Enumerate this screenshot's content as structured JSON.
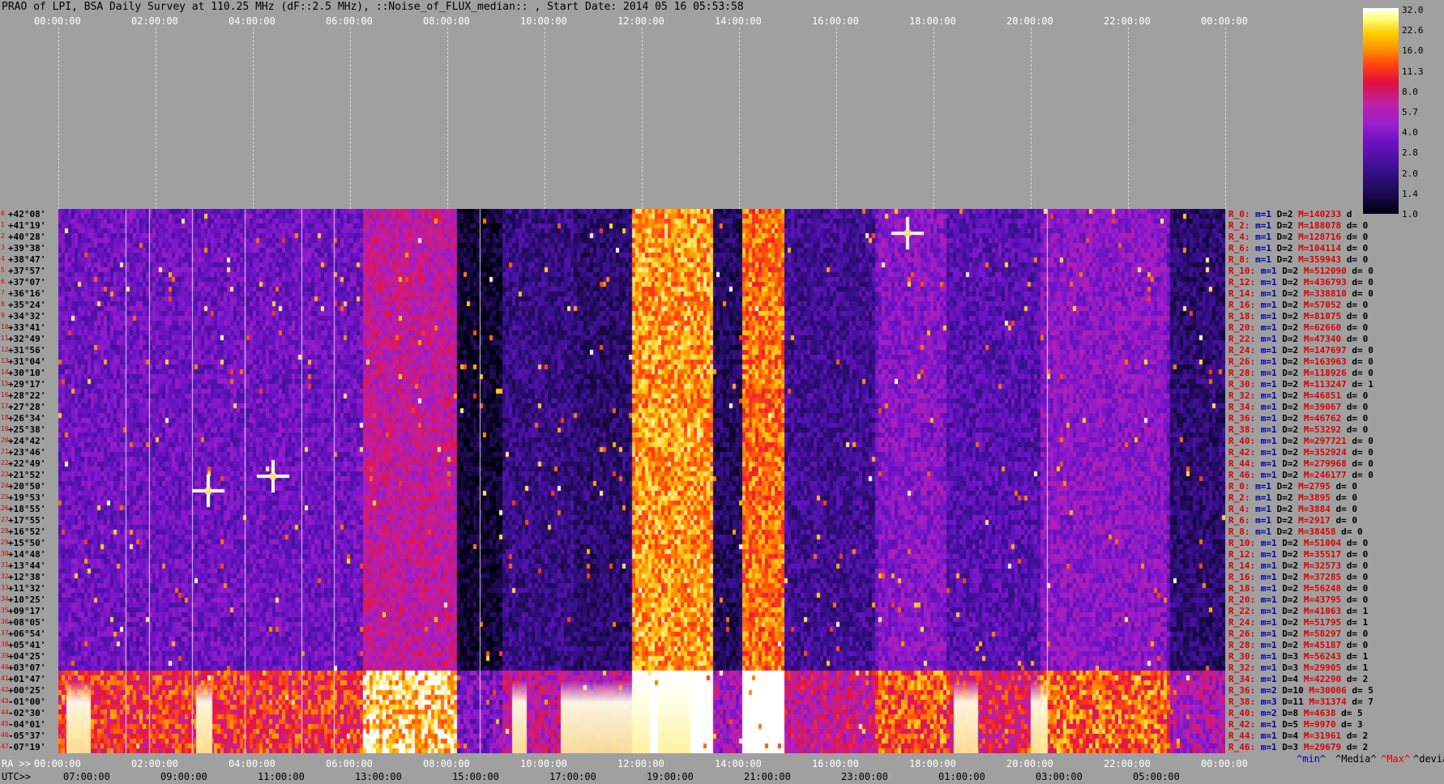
{
  "header": {
    "title": "PRAO of LPI, BSA Daily Survey at 110.25 MHz (dF::2.5 MHz), ::Noise_of_FLUX_median:: , Start Date: 2014 05 16 05:53:58"
  },
  "top_axis": {
    "ticks": [
      "00:00:00",
      "02:00:00",
      "04:00:00",
      "06:00:00",
      "08:00:00",
      "10:00:00",
      "12:00:00",
      "14:00:00",
      "16:00:00",
      "18:00:00",
      "20:00:00",
      "22:00:00",
      "00:00:00"
    ]
  },
  "colorbar": {
    "ticks": [
      "32.0",
      "22.6",
      "16.0",
      "11.3",
      "8.0",
      "5.7",
      "4.0",
      "2.8",
      "2.0",
      "1.4",
      "1.0"
    ]
  },
  "declinations": [
    "+42°08'",
    "+41°19'",
    "+40°28'",
    "+39°38'",
    "+38°47'",
    "+37°57'",
    "+37°07'",
    "+36°16'",
    "+35°24'",
    "+34°32'",
    "+33°41'",
    "+32°49'",
    "+31°56'",
    "+31°04'",
    "+30°10'",
    "+29°17'",
    "+28°22'",
    "+27°28'",
    "+26°34'",
    "+25°38'",
    "+24°42'",
    "+23°46'",
    "+22°49'",
    "+21°52'",
    "+20°50'",
    "+19°53'",
    "+18°55'",
    "+17°55'",
    "+16°52'",
    "+15°50'",
    "+14°48'",
    "+13°44'",
    "+12°38'",
    "+11°32'",
    "+10°25'",
    "+09°17'",
    "+08°05'",
    "+06°54'",
    "+05°41'",
    "+04°25'",
    "+03°07'",
    "+01°47'",
    "+00°25'",
    "-01°00'",
    "-02°30'",
    "-04°01'",
    "-05°37'",
    "-07°19'"
  ],
  "row_labels": [
    {
      "r": "R_0:",
      "m": "m=1",
      "d": "D=2",
      "M": "M=140233",
      "dv": "d"
    },
    {
      "r": "R_2:",
      "m": "m=1",
      "d": "D=2",
      "M": "M=188078",
      "dv": "d= 0"
    },
    {
      "r": "R_4:",
      "m": "m=1",
      "d": "D=2",
      "M": "M=128716",
      "dv": "d= 0"
    },
    {
      "r": "R_6:",
      "m": "m=1",
      "d": "D=2",
      "M": "M=104114",
      "dv": "d= 0"
    },
    {
      "r": "R_8:",
      "m": "m=1",
      "d": "D=2",
      "M": "M=359943",
      "dv": "d= 0"
    },
    {
      "r": "R_10:",
      "m": "m=1",
      "d": "D=2",
      "M": "M=512090",
      "dv": "d= 0"
    },
    {
      "r": "R_12:",
      "m": "m=1",
      "d": "D=2",
      "M": "M=436793",
      "dv": "d= 0"
    },
    {
      "r": "R_14:",
      "m": "m=1",
      "d": "D=2",
      "M": "M=338810",
      "dv": "d= 0"
    },
    {
      "r": "R_16:",
      "m": "m=1",
      "d": "D=2",
      "M": "M=57052",
      "dv": "d= 0"
    },
    {
      "r": "R_18:",
      "m": "m=1",
      "d": "D=2",
      "M": "M=81075",
      "dv": "d= 0"
    },
    {
      "r": "R_20:",
      "m": "m=1",
      "d": "D=2",
      "M": "M=62660",
      "dv": "d= 0"
    },
    {
      "r": "R_22:",
      "m": "m=1",
      "d": "D=2",
      "M": "M=47340",
      "dv": "d= 0"
    },
    {
      "r": "R_24:",
      "m": "m=1",
      "d": "D=2",
      "M": "M=147697",
      "dv": "d= 0"
    },
    {
      "r": "R_26:",
      "m": "m=1",
      "d": "D=2",
      "M": "M=163963",
      "dv": "d= 0"
    },
    {
      "r": "R_28:",
      "m": "m=1",
      "d": "D=2",
      "M": "M=118926",
      "dv": "d= 0"
    },
    {
      "r": "R_30:",
      "m": "m=1",
      "d": "D=2",
      "M": "M=113247",
      "dv": "d= 1"
    },
    {
      "r": "R_32:",
      "m": "m=1",
      "d": "D=2",
      "M": "M=46851",
      "dv": "d= 0"
    },
    {
      "r": "R_34:",
      "m": "m=1",
      "d": "D=2",
      "M": "M=39067",
      "dv": "d= 0"
    },
    {
      "r": "R_36:",
      "m": "m=1",
      "d": "D=2",
      "M": "M=46762",
      "dv": "d= 0"
    },
    {
      "r": "R_38:",
      "m": "m=1",
      "d": "D=2",
      "M": "M=53292",
      "dv": "d= 0"
    },
    {
      "r": "R_40:",
      "m": "m=1",
      "d": "D=2",
      "M": "M=297721",
      "dv": "d= 0"
    },
    {
      "r": "R_42:",
      "m": "m=1",
      "d": "D=2",
      "M": "M=352924",
      "dv": "d= 0"
    },
    {
      "r": "R_44:",
      "m": "m=1",
      "d": "D=2",
      "M": "M=279968",
      "dv": "d= 0"
    },
    {
      "r": "R_46:",
      "m": "m=1",
      "d": "D=2",
      "M": "M=246177",
      "dv": "d= 0"
    },
    {
      "r": "R_0:",
      "m": "m=1",
      "d": "D=2",
      "M": "M=2795",
      "dv": "d= 0"
    },
    {
      "r": "R_2:",
      "m": "m=1",
      "d": "D=2",
      "M": "M=3895",
      "dv": "d= 0"
    },
    {
      "r": "R_4:",
      "m": "m=1",
      "d": "D=2",
      "M": "M=3884",
      "dv": "d= 0"
    },
    {
      "r": "R_6:",
      "m": "m=1",
      "d": "D=2",
      "M": "M=2917",
      "dv": "d= 0"
    },
    {
      "r": "R_8:",
      "m": "m=1",
      "d": "D=2",
      "M": "M=38458",
      "dv": "d= 0"
    },
    {
      "r": "R_10:",
      "m": "m=1",
      "d": "D=2",
      "M": "M=51004",
      "dv": "d= 0"
    },
    {
      "r": "R_12:",
      "m": "m=1",
      "d": "D=2",
      "M": "M=35517",
      "dv": "d= 0"
    },
    {
      "r": "R_14:",
      "m": "m=1",
      "d": "D=2",
      "M": "M=32573",
      "dv": "d= 0"
    },
    {
      "r": "R_16:",
      "m": "m=1",
      "d": "D=2",
      "M": "M=37285",
      "dv": "d= 0"
    },
    {
      "r": "R_18:",
      "m": "m=1",
      "d": "D=2",
      "M": "M=56248",
      "dv": "d= 0"
    },
    {
      "r": "R_20:",
      "m": "m=1",
      "d": "D=2",
      "M": "M=43795",
      "dv": "d= 0"
    },
    {
      "r": "R_22:",
      "m": "m=1",
      "d": "D=2",
      "M": "M=41063",
      "dv": "d= 1"
    },
    {
      "r": "R_24:",
      "m": "m=1",
      "d": "D=2",
      "M": "M=51795",
      "dv": "d= 1"
    },
    {
      "r": "R_26:",
      "m": "m=1",
      "d": "D=2",
      "M": "M=58297",
      "dv": "d= 0"
    },
    {
      "r": "R_28:",
      "m": "m=1",
      "d": "D=2",
      "M": "M=45187",
      "dv": "d= 0"
    },
    {
      "r": "R_30:",
      "m": "m=1",
      "d": "D=3",
      "M": "M=56243",
      "dv": "d= 1"
    },
    {
      "r": "R_32:",
      "m": "m=1",
      "d": "D=3",
      "M": "M=29905",
      "dv": "d= 1"
    },
    {
      "r": "R_34:",
      "m": "m=1",
      "d": "D=4",
      "M": "M=42290",
      "dv": "d= 2"
    },
    {
      "r": "R_36:",
      "m": "m=2",
      "d": "D=10",
      "M": "M=30006",
      "dv": "d= 5"
    },
    {
      "r": "R_38:",
      "m": "m=3",
      "d": "D=11",
      "M": "M=31374",
      "dv": "d= 7"
    },
    {
      "r": "R_40:",
      "m": "m=2",
      "d": "D=8",
      "M": "M=4638",
      "dv": "d= 5"
    },
    {
      "r": "R_42:",
      "m": "m=1",
      "d": "D=5",
      "M": "M=9970",
      "dv": "d= 3"
    },
    {
      "r": "R_44:",
      "m": "m=1",
      "d": "D=4",
      "M": "M=31961",
      "dv": "d= 2"
    },
    {
      "r": "R_46:",
      "m": "m=1",
      "d": "D=3",
      "M": "M=29679",
      "dv": "d= 2"
    }
  ],
  "legend_footer": {
    "min": "^min^",
    "media": "^Media^",
    "max": "^Max^",
    "devia": "^devia"
  },
  "bottom_axis": {
    "ra_caption": "RA >>",
    "utc_caption": "UTC>>",
    "ra_ticks": [
      "00:00:00",
      "02:00:00",
      "04:00:00",
      "06:00:00",
      "08:00:00",
      "10:00:00",
      "12:00:00",
      "14:00:00",
      "16:00:00",
      "18:00:00",
      "20:00:00",
      "22:00:00",
      "00:00:00"
    ],
    "utc_ticks": [
      "07:00:00",
      "09:00:00",
      "11:00:00",
      "13:00:00",
      "15:00:00",
      "17:00:00",
      "19:00:00",
      "21:00:00",
      "23:00:00",
      "01:00:00",
      "03:00:00",
      "05:00:00"
    ]
  },
  "colors": {
    "background": "#a0a0a0",
    "label_red": "#dd0000",
    "label_blue": "#0000aa"
  }
}
